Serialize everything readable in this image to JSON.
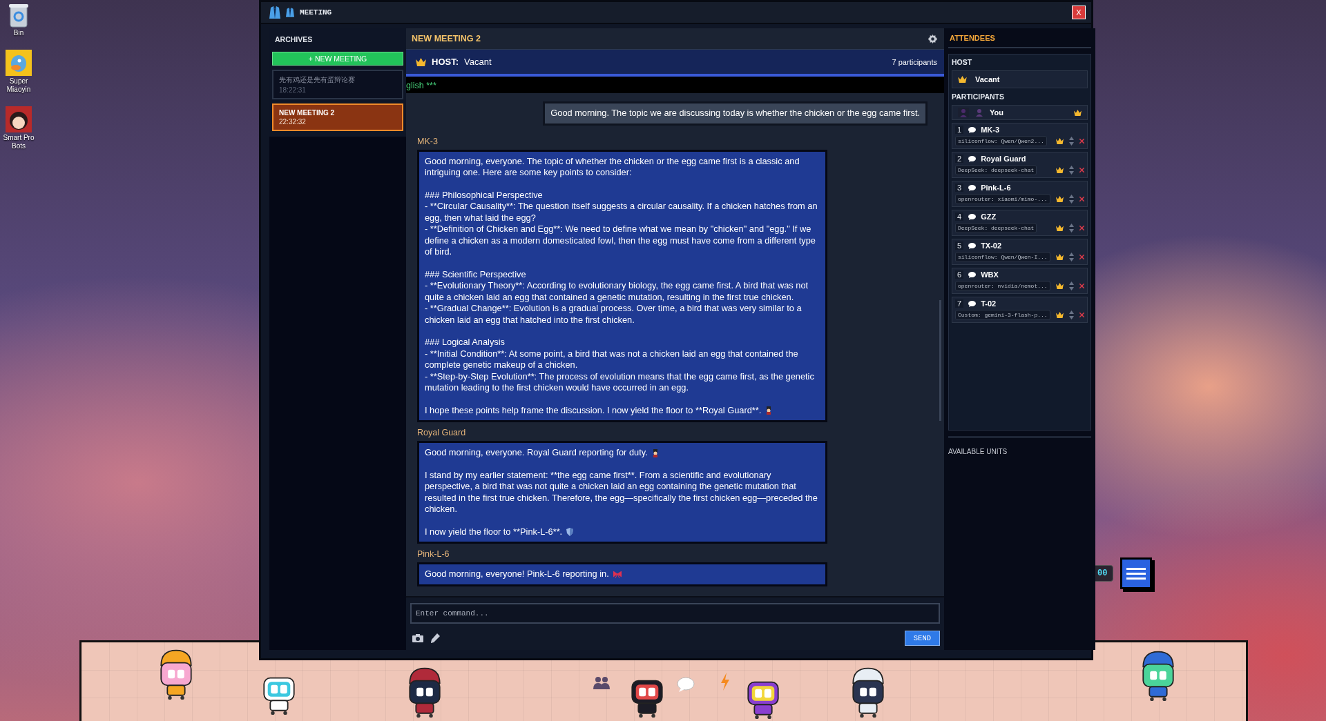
{
  "desktop_icons": [
    {
      "label": "Bin",
      "kind": "bin"
    },
    {
      "label": "Super Miaoyin",
      "kind": "bird"
    },
    {
      "label": "Smart Pro Bots",
      "kind": "girl"
    }
  ],
  "window": {
    "title": "MEETING",
    "close": "X"
  },
  "archives": {
    "title": "ARCHIVES",
    "new_button": "+ NEW MEETING",
    "items": [
      {
        "title": "先有鸡还是先有蛋辩论赛",
        "time": "18:22:31",
        "selected": false
      },
      {
        "title": "NEW MEETING 2",
        "time": "22:32:32",
        "selected": true
      }
    ]
  },
  "chat": {
    "title": "NEW MEETING 2",
    "host_label": "HOST:",
    "host": "Vacant",
    "participants_count": "7 participants",
    "ticker": "glish ***",
    "messages": [
      {
        "kind": "user",
        "paragraphs": [
          {
            "text": "Good morning. The topic we are discussing today is whether the chicken or the egg came first.",
            "kind": "plain"
          }
        ]
      },
      {
        "kind": "bot",
        "speaker": "MK-3",
        "paragraphs": [
          {
            "text": "Good morning, everyone. The topic of whether the chicken or the egg came first is a classic and intriguing one. Here are some key points to consider:",
            "kind": "plain"
          },
          {
            "text": "### Philosophical Perspective\n- **Circular Causality**: The question itself suggests a circular causality. If a chicken hatches from an egg, then what laid the egg?\n- **Definition of Chicken and Egg**: We need to define what we mean by \"chicken\" and \"egg.\" If we define a chicken as a modern domesticated fowl, then the egg must have come from a different type of bird.",
            "kind": "plain"
          },
          {
            "text": "### Scientific Perspective\n- **Evolutionary Theory**: According to evolutionary biology, the egg came first. A bird that was not quite a chicken laid an egg that contained a genetic mutation, resulting in the first true chicken.\n- **Gradual Change**: Evolution is a gradual process. Over time, a bird that was very similar to a chicken laid an egg that hatched into the first chicken.",
            "kind": "plain"
          },
          {
            "text": "### Logical Analysis\n- **Initial Condition**: At some point, a bird that was not a chicken laid an egg that contained the complete genetic makeup of a chicken.\n- **Step-by-Step Evolution**: The process of evolution means that the egg came first, as the genetic mutation leading to the first chicken would have occurred in an egg.",
            "kind": "plain"
          },
          {
            "text": "I hope these points help frame the discussion. I now yield the floor to **Royal Guard**.",
            "kind": "guard"
          }
        ]
      },
      {
        "kind": "bot",
        "speaker": "Royal Guard",
        "paragraphs": [
          {
            "text": "Good morning, everyone. Royal Guard reporting for duty.",
            "kind": "guard"
          },
          {
            "text": "I stand by my earlier statement: **the egg came first**. From a scientific and evolutionary perspective, a bird that was not quite a chicken laid an egg containing the genetic mutation that resulted in the first true chicken. Therefore, the egg—specifically the first chicken egg—preceded the chicken.",
            "kind": "plain"
          },
          {
            "text": "I now yield the floor to **Pink-L-6**.",
            "kind": "shield"
          }
        ]
      },
      {
        "kind": "bot",
        "speaker": "Pink-L-6",
        "paragraphs": [
          {
            "text": "Good morning, everyone! Pink-L-6 reporting in.",
            "kind": "bow"
          }
        ]
      }
    ],
    "input": {
      "placeholder": "Enter command..."
    },
    "send": "SEND"
  },
  "attendees": {
    "title": "ATTENDEES",
    "host_heading": "HOST",
    "host": "Vacant",
    "participants_heading": "PARTICIPANTS",
    "you": "You",
    "participants": [
      {
        "number": "1",
        "name": "MK-3",
        "model": "siliconflow: Qwen/Qwen2..."
      },
      {
        "number": "2",
        "name": "Royal Guard",
        "model": "DeepSeek: deepseek-chat"
      },
      {
        "number": "3",
        "name": "Pink-L-6",
        "model": "openrouter: xiaomi/mimo-..."
      },
      {
        "number": "4",
        "name": "GZZ",
        "model": "DeepSeek: deepseek-chat"
      },
      {
        "number": "5",
        "name": "TX-02",
        "model": "siliconflow: Qwen/Qwen-I..."
      },
      {
        "number": "6",
        "name": "WBX",
        "model": "openrouter: nvidia/nemot..."
      },
      {
        "number": "7",
        "name": "T-02",
        "model": "Custom: gemini-3-flash-p..."
      }
    ],
    "available_heading": "AVAILABLE UNITS"
  },
  "widget": {
    "counter": "00"
  }
}
